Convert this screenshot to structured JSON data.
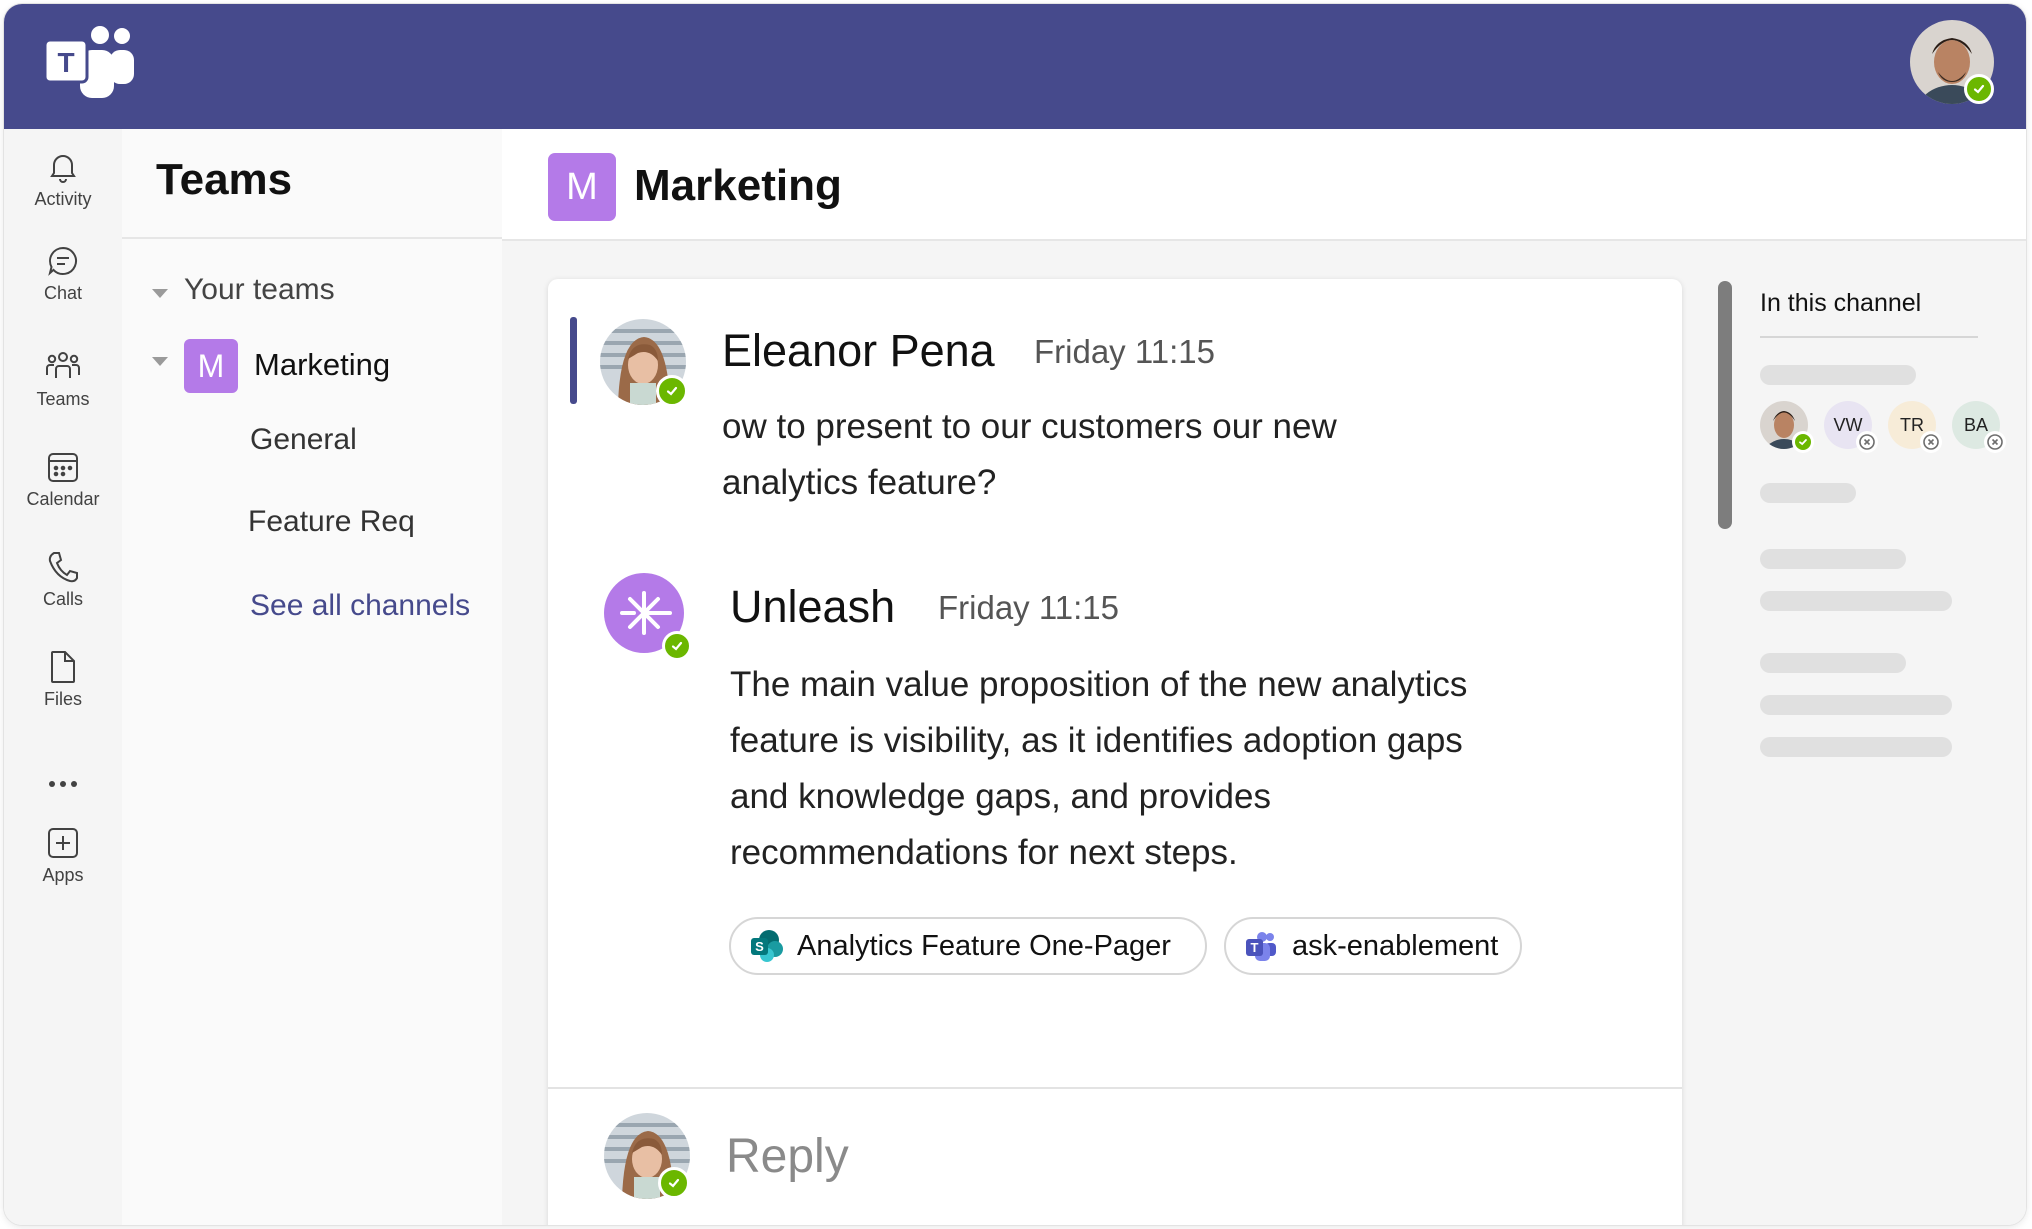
{
  "app": {
    "logo_icon": "teams-logo-icon",
    "accent": "#464a8c",
    "team_color": "#b47ae8",
    "presence_color": "#6bb700"
  },
  "rail": {
    "items": [
      {
        "label": "Activity",
        "icon": "bell-icon"
      },
      {
        "label": "Chat",
        "icon": "chat-bubble-icon"
      },
      {
        "label": "Teams",
        "icon": "people-icon"
      },
      {
        "label": "Calendar",
        "icon": "calendar-icon"
      },
      {
        "label": "Calls",
        "icon": "phone-icon"
      },
      {
        "label": "Files",
        "icon": "file-icon"
      },
      {
        "label": "Apps",
        "icon": "plus-square-icon"
      }
    ],
    "more_icon": "more-horizontal-icon"
  },
  "teams_panel": {
    "title": "Teams",
    "section_label": "Your teams",
    "team": {
      "initial": "M",
      "name": "Marketing"
    },
    "channels": [
      "General",
      "Feature Req"
    ],
    "see_all": "See all channels"
  },
  "channel": {
    "initial": "M",
    "title": "Marketing"
  },
  "messages": [
    {
      "author": "Eleanor Pena",
      "time": "Friday 11:15",
      "lines": [
        "ow to present to our customers our new",
        "analytics feature?"
      ]
    },
    {
      "author": "Unleash",
      "time": "Friday 11:15",
      "lines": [
        "The main value proposition of the new analytics",
        "feature is visibility, as it identifies adoption gaps",
        "and knowledge gaps, and provides",
        "recommendations for next steps."
      ],
      "chips": [
        {
          "label": "Analytics Feature One-Pager",
          "icon": "sharepoint-icon"
        },
        {
          "label": "ask-enablement",
          "icon": "teams-icon"
        }
      ]
    }
  ],
  "reply": {
    "placeholder": "Reply"
  },
  "side_panel": {
    "title": "In this channel",
    "members": [
      "VW",
      "TR",
      "BA"
    ]
  }
}
